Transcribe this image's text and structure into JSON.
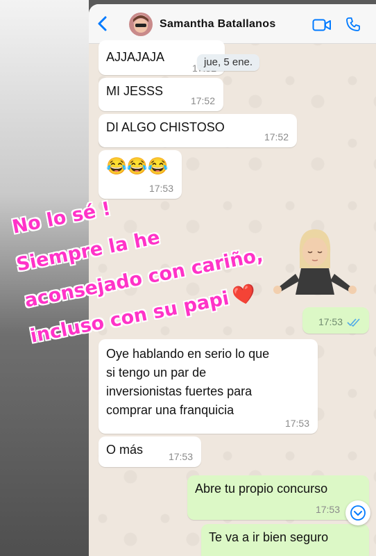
{
  "header": {
    "contact_name": "Samantha  Batallanos"
  },
  "chat": {
    "date_chip": "jue, 5 ene.",
    "messages": [
      {
        "text": "AJJAJAJA",
        "time": "17:52"
      },
      {
        "text": "MI JESSS",
        "time": "17:52"
      },
      {
        "text": "DI ALGO CHISTOSO",
        "time": "17:52"
      },
      {
        "text": "😂😂😂",
        "time": "17:53"
      },
      {
        "text": "",
        "time": "17:53",
        "status": "read"
      },
      {
        "text": "Oye hablando en serio lo que\nsi tengo un par de\ninversionistas fuertes para\ncomprar una franquicia",
        "time": "17:53"
      },
      {
        "text": "O más",
        "time": "17:53"
      },
      {
        "text": "Abre tu propio concurso",
        "time": "17:53"
      },
      {
        "text": "Te va a ir bien seguro",
        "time": ""
      }
    ]
  },
  "overlay": {
    "lines": [
      "No lo sé !",
      "Siempre la he",
      "aconsejado con cariño,",
      "incluso con su papi"
    ],
    "heart": "❤️",
    "color": "#ff33c8"
  },
  "colors": {
    "accent": "#007aff",
    "outgoing_bubble": "#dcf8c6",
    "incoming_bubble": "#ffffff",
    "read_ticks": "#4fa9e8"
  },
  "icons": [
    "back-chevron-icon",
    "video-call-icon",
    "phone-call-icon",
    "double-check-icon",
    "scroll-down-icon",
    "heart-icon"
  ]
}
